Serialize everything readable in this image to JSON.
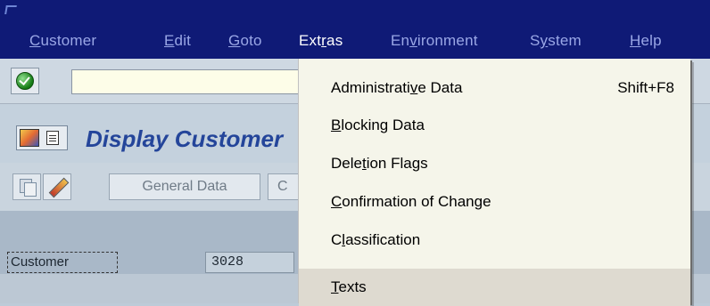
{
  "menubar": {
    "items": [
      {
        "pre": "",
        "u": "C",
        "post": "ustomer",
        "active": false
      },
      {
        "pre": "",
        "u": "E",
        "post": "dit",
        "active": false
      },
      {
        "pre": "",
        "u": "G",
        "post": "oto",
        "active": false
      },
      {
        "pre": "Ext",
        "u": "r",
        "post": "as",
        "active": true
      },
      {
        "pre": "En",
        "u": "v",
        "post": "ironment",
        "active": false
      },
      {
        "pre": "S",
        "u": "y",
        "post": "stem",
        "active": false
      },
      {
        "pre": "",
        "u": "H",
        "post": "elp",
        "active": false
      }
    ]
  },
  "command": {
    "value": ""
  },
  "title": {
    "text": "Display Customer"
  },
  "toolbar": {
    "general_data_label": "General Data",
    "next_label": "C"
  },
  "form": {
    "customer_label": "Customer",
    "customer_value": "3028"
  },
  "extras_menu": {
    "items": [
      {
        "pre": "Administrati",
        "u": "v",
        "post": "e Data",
        "accel": "Shift+F8",
        "highlighted": false
      },
      {
        "pre": "",
        "u": "B",
        "post": "locking Data",
        "accel": "",
        "highlighted": false
      },
      {
        "pre": "Dele",
        "u": "t",
        "post": "ion Flags",
        "accel": "",
        "highlighted": false
      },
      {
        "pre": "",
        "u": "C",
        "post": "onfirmation of Change",
        "accel": "",
        "highlighted": false
      },
      {
        "pre": "C",
        "u": "l",
        "post": "assification",
        "accel": "",
        "highlighted": false
      },
      {
        "pre": "",
        "u": "T",
        "post": "exts",
        "accel": "",
        "highlighted": true
      }
    ]
  },
  "colors": {
    "menubar_bg": "#0f1a76",
    "menu_inactive": "#9aa7e6",
    "menu_active": "#ffffff",
    "title_text": "#24459a",
    "dropdown_bg": "#f5f5ea",
    "dropdown_highlight": "#dedad0"
  }
}
